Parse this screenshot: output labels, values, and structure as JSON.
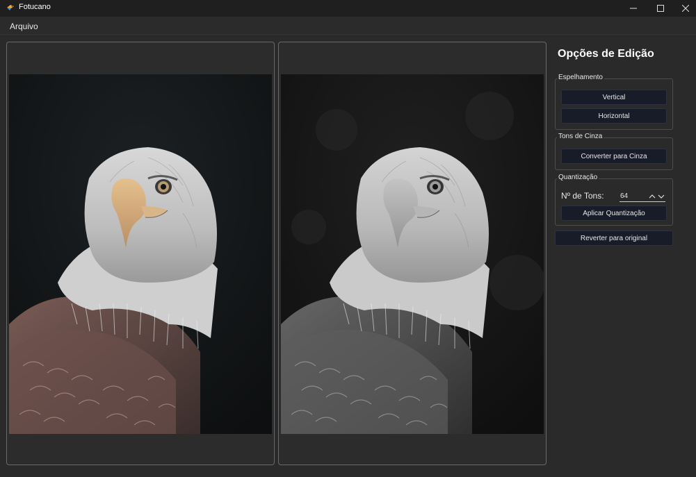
{
  "window": {
    "title": "Fotucano",
    "controls": [
      "minimize-icon",
      "maximize-icon",
      "close-icon"
    ]
  },
  "menu": {
    "items": [
      "Arquivo"
    ]
  },
  "images": {
    "original": {
      "description_icon": "eagle-photo-color"
    },
    "edited": {
      "description_icon": "eagle-photo-grayscale"
    }
  },
  "sidebar": {
    "title": "Opções de Edição",
    "mirror": {
      "label": "Espelhamento",
      "vertical": "Vertical",
      "horizontal": "Horizontal"
    },
    "gray": {
      "label": "Tons de Cinza",
      "convert": "Converter para Cinza"
    },
    "quant": {
      "label": "Quantização",
      "tons_label": "Nº de Tons:",
      "tons_value": "64",
      "apply": "Aplicar Quantização"
    },
    "revert": "Reverter para original"
  },
  "colors": {
    "background": "#2a2a2a",
    "button": "#181b28",
    "panel_border": "#6a6a6a"
  }
}
